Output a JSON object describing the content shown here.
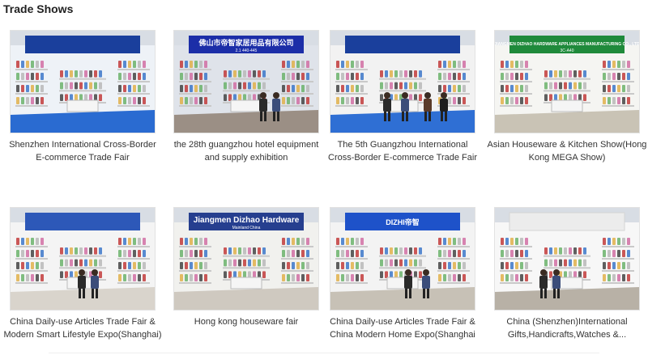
{
  "section": {
    "title": "Trade Shows"
  },
  "cards": [
    {
      "caption": "Shenzhen International Cross-Border\nE-commerce Trade Fair",
      "image": "booth-photo-shenzhen",
      "colors": {
        "banner": "#1a3f9c",
        "floor": "#2a6bd1",
        "walls": "#eef2f7"
      }
    },
    {
      "caption": "the 28th guangzhou hotel equipment\nand supply exhibition",
      "image": "booth-photo-guangzhou-hotel",
      "banner_text": "佛山市帝智家居用品有限公司",
      "banner_sub": "2.1 440-445",
      "colors": {
        "banner": "#1c2ea8",
        "floor": "#9b8f85",
        "walls": "#dfe3ea"
      }
    },
    {
      "caption": "The 5th Guangzhou International\nCross-Border E-commerce Trade Fair",
      "image": "booth-photo-guangzhou-crossborder",
      "colors": {
        "banner": "#1a3f9c",
        "floor": "#2f6fd4",
        "walls": "#f2f2f2"
      }
    },
    {
      "caption": "Asian Houseware & Kitchen Show(Hong\nKong MEGA Show)",
      "image": "booth-photo-hongkong-mega",
      "banner_text": "JIANGMEN DIZHAO HARDWARE APPLIANCES MANUFACTURING CO., LTD",
      "banner_sub": "3C-A40",
      "colors": {
        "banner": "#1f8a3b",
        "floor": "#c9c3b5",
        "walls": "#f5f5f2"
      }
    },
    {
      "caption": "China Daily-use Articles Trade Fair &\nModern Smart Lifestyle Expo(Shanghai)",
      "image": "booth-photo-shanghai-dailyuse",
      "colors": {
        "banner": "#2d58b8",
        "floor": "#d9d4cc",
        "walls": "#f4f4f4"
      }
    },
    {
      "caption": "Hong kong houseware fair",
      "image": "booth-photo-hongkong-houseware",
      "banner_text": "Jiangmen Dizhao Hardware",
      "banner_sub": "Mainland China",
      "colors": {
        "banner": "#263f8f",
        "floor": "#cfc9c0",
        "walls": "#f1f1ee"
      }
    },
    {
      "caption": "China Daily-use Articles Trade Fair &\nChina Modern Home Expo(Shanghai",
      "image": "booth-photo-shanghai-modernhome",
      "banner_text": "DIZHI帝智",
      "colors": {
        "banner": "#1e52c9",
        "floor": "#c7c1b6",
        "walls": "#f3f3f3"
      }
    },
    {
      "caption": "China (Shenzhen)International\nGifts,Handicrafts,Watches &...",
      "image": "booth-photo-shenzhen-gifts",
      "colors": {
        "banner": "#ffffff",
        "floor": "#b8b1a6",
        "walls": "#f7f7f7"
      }
    }
  ]
}
